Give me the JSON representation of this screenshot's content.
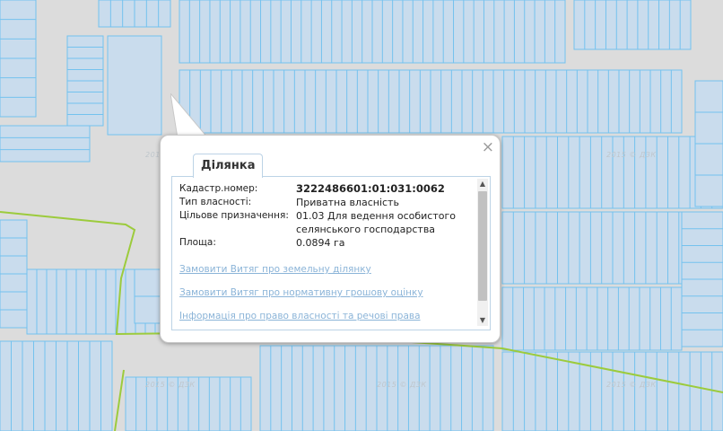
{
  "popup": {
    "tab_label": "Ділянка",
    "close_icon": "×",
    "fields": [
      {
        "label": "Кадастр.номер:",
        "value": "3222486601:01:031:0062"
      },
      {
        "label": "Тип власності:",
        "value": "Приватна власність"
      },
      {
        "label": "Цільове призначення:",
        "value": "01.03 Для ведення особистого селянського господарства"
      },
      {
        "label": "Площа:",
        "value": "0.0894 га"
      }
    ],
    "links": [
      "Замовити Витяг про земельну ділянку",
      "Замовити Витяг про нормативну грошову оцінку",
      "Інформація про право власності та речові права"
    ]
  },
  "map": {
    "watermark": "2015 © ДЗК",
    "colors": {
      "background": "#dcdcdc",
      "parcel_fill": "#c9dced",
      "parcel_stroke": "#74c2ee",
      "boundary_line": "#9ccb3c"
    }
  }
}
